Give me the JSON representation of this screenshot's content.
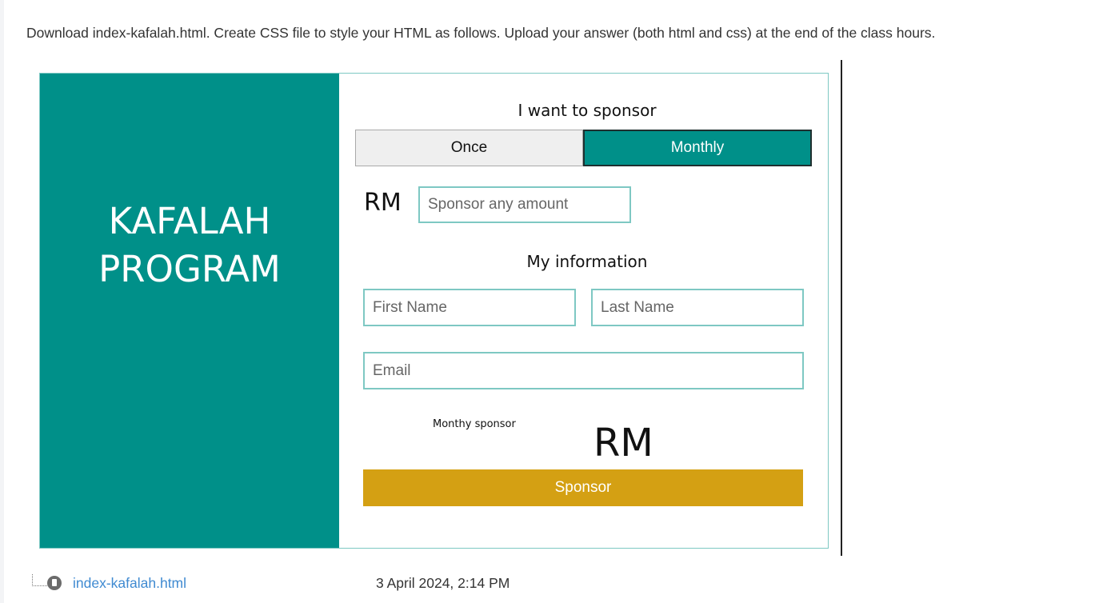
{
  "instructions": "Download index-kafalah.html. Create CSS file to style your HTML as follows.  Upload your answer (both html and css) at the end of the class hours.",
  "mockup": {
    "brand_line1": "KAFALAH",
    "brand_line2": "PROGRAM",
    "sponsor_heading": "I want to sponsor",
    "toggle_once": "Once",
    "toggle_monthly": "Monthly",
    "currency_label": "RM",
    "amount_placeholder": "Sponsor any amount",
    "info_heading": "My information",
    "first_name_placeholder": "First Name",
    "last_name_placeholder": "Last Name",
    "email_placeholder": "Email",
    "summary_label": "Monthy sponsor",
    "summary_currency": "RM",
    "submit_label": "Sponsor"
  },
  "attachment": {
    "file_name": "index-kafalah.html",
    "date": "3 April 2024, 2:14 PM"
  },
  "colors": {
    "teal": "#009089",
    "gold": "#d4a013",
    "field_border": "#7ec8c3",
    "link": "#3f8ad1"
  },
  "icons": [
    "tree-connector-icon",
    "file-icon"
  ]
}
